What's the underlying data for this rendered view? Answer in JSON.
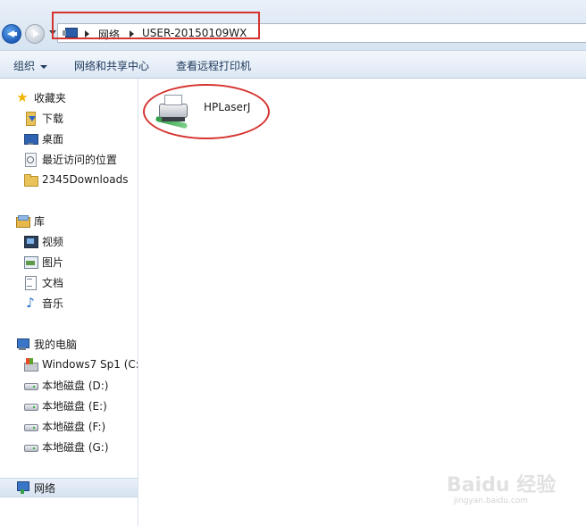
{
  "address_bar": {
    "breadcrumbs": [
      "网络",
      "USER-20150109WX"
    ]
  },
  "toolbar": {
    "organize_label": "组织",
    "network_sharing_label": "网络和共享中心",
    "remote_printers_label": "查看远程打印机"
  },
  "sidebar": {
    "favorites": {
      "header": "收藏夹",
      "icon": "star-icon",
      "items": [
        {
          "label": "下载",
          "icon": "download-folder-icon"
        },
        {
          "label": "桌面",
          "icon": "desktop-icon"
        },
        {
          "label": "最近访问的位置",
          "icon": "recent-places-icon"
        },
        {
          "label": "2345Downloads",
          "icon": "folder-icon"
        }
      ]
    },
    "libraries": {
      "header": "库",
      "icon": "library-icon",
      "items": [
        {
          "label": "视频",
          "icon": "video-icon"
        },
        {
          "label": "图片",
          "icon": "picture-icon"
        },
        {
          "label": "文档",
          "icon": "document-icon"
        },
        {
          "label": "音乐",
          "icon": "music-icon"
        }
      ]
    },
    "computer": {
      "header": "我的电脑",
      "icon": "computer-icon",
      "items": [
        {
          "label": "Windows7 Sp1 (C:",
          "icon": "windows-drive-icon"
        },
        {
          "label": "本地磁盘 (D:)",
          "icon": "drive-icon"
        },
        {
          "label": "本地磁盘 (E:)",
          "icon": "drive-icon"
        },
        {
          "label": "本地磁盘 (F:)",
          "icon": "drive-icon"
        },
        {
          "label": "本地磁盘 (G:)",
          "icon": "drive-icon"
        }
      ]
    },
    "network": {
      "header": "网络",
      "icon": "network-icon",
      "selected": true
    }
  },
  "content": {
    "items": [
      {
        "label": "HPLaserJ",
        "icon": "printer-icon"
      }
    ]
  },
  "annotation_color": "#d5342f",
  "watermark": {
    "logo": "Baidu 经验",
    "url": "jingyan.baidu.com"
  }
}
